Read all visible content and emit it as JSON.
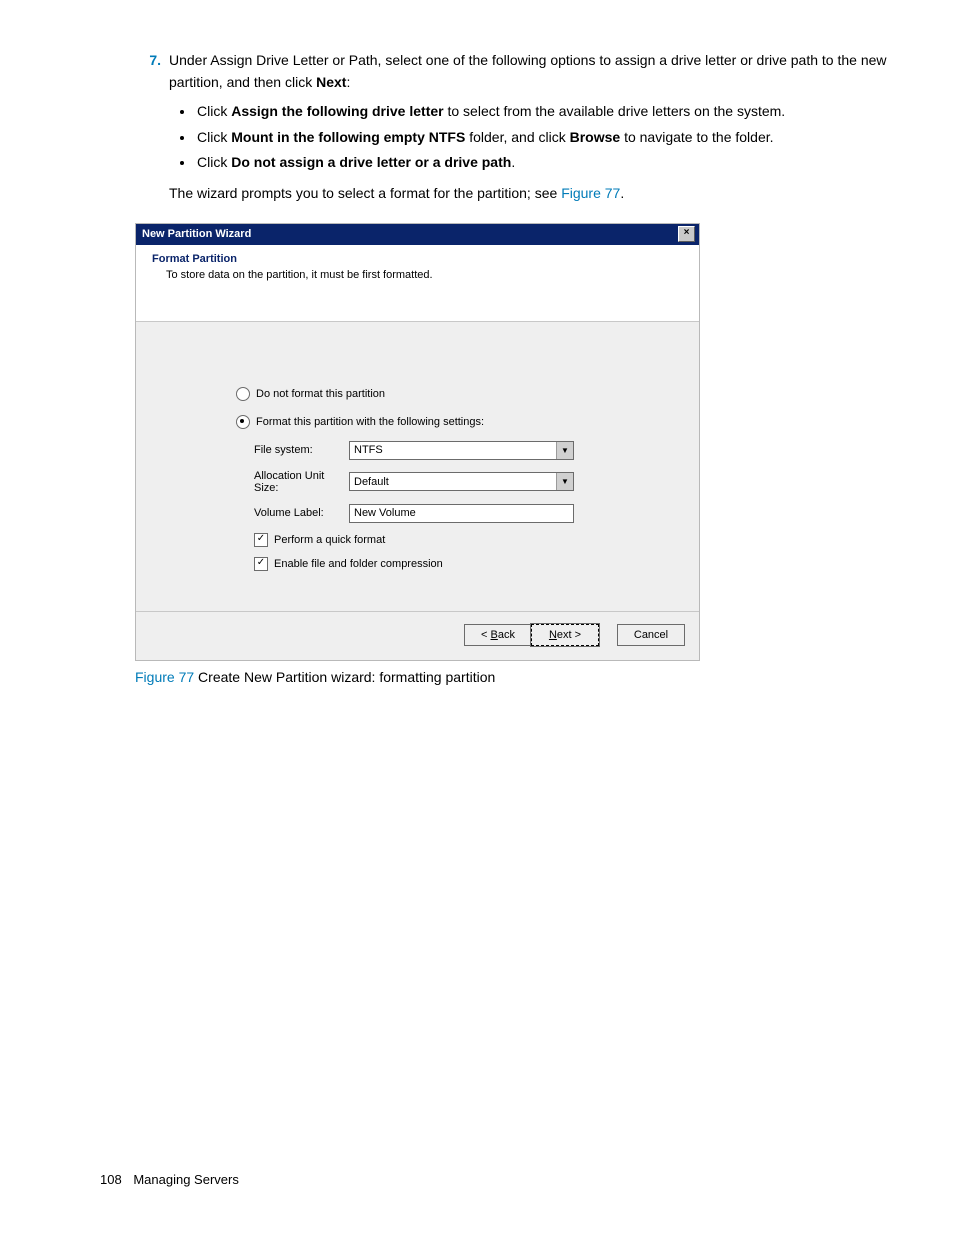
{
  "step": {
    "number": "7.",
    "text_a": "Under Assign Drive Letter or Path, select one of the following options to assign a drive letter or drive path to the new partition, and then click ",
    "text_b_bold": "Next",
    "text_c": ":",
    "bullets": [
      {
        "pre": "Click ",
        "bold": "Assign the following drive letter",
        "post": " to select from the available drive letters on the system."
      },
      {
        "pre": "Click ",
        "bold": "Mount in the following empty NTFS",
        "mid": " folder, and click ",
        "bold2": "Browse",
        "post": " to navigate to the folder."
      },
      {
        "pre": "Click ",
        "bold": "Do not assign a drive letter or a drive path",
        "post": "."
      }
    ],
    "after_a": "The wizard prompts you to select a format for the partition; see ",
    "after_link": "Figure 77",
    "after_b": "."
  },
  "wizard": {
    "title": "New Partition Wizard",
    "header_title": "Format Partition",
    "header_sub": "To store data on the partition, it must be first formatted.",
    "opt1": "Do not format this partition",
    "opt2": "Format this partition with the following settings:",
    "fields": {
      "fs_label": "File system:",
      "fs_value": "NTFS",
      "au_label": "Allocation Unit Size:",
      "au_value": "Default",
      "vl_label": "Volume Label:",
      "vl_value": "New Volume"
    },
    "chk1": "Perform a quick format",
    "chk2": "Enable file and folder compression",
    "buttons": {
      "back_pre": "< ",
      "back_u": "B",
      "back_post": "ack",
      "next_u": "N",
      "next_post": "ext >",
      "cancel": "Cancel"
    }
  },
  "caption": {
    "label": "Figure 77",
    "text": "  Create New Partition wizard: formatting partition"
  },
  "footer": {
    "page": "108",
    "section": "Managing Servers"
  }
}
